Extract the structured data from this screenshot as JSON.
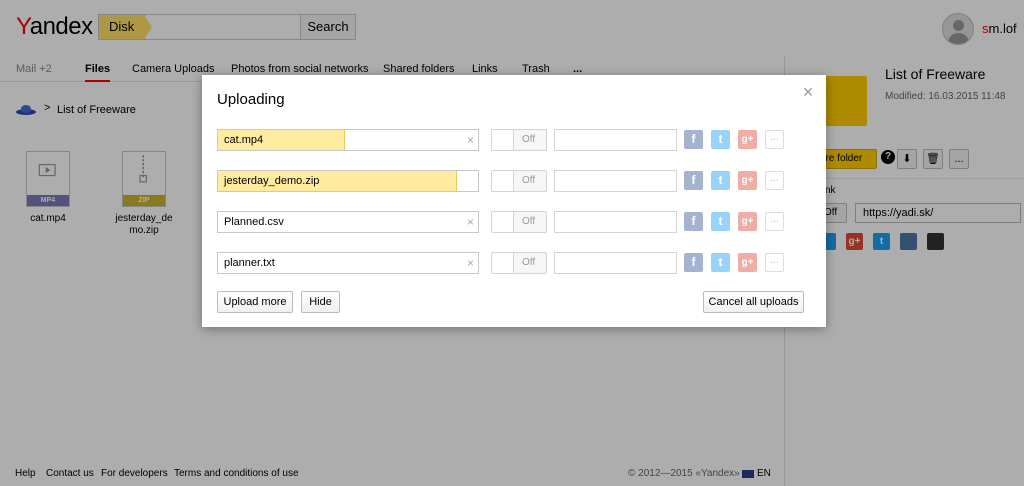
{
  "header": {
    "logo_y": "Y",
    "logo_rest": "andex",
    "search_tag": "Disk",
    "search_button": "Search",
    "user_first_letter": "s",
    "user_rest": "m.lof"
  },
  "tabs": [
    {
      "label": "Mail +2"
    },
    {
      "label": "Files"
    },
    {
      "label": "Camera Uploads"
    },
    {
      "label": "Photos from social networks"
    },
    {
      "label": "Shared folders"
    },
    {
      "label": "Links"
    },
    {
      "label": "Trash"
    },
    {
      "label": "..."
    }
  ],
  "breadcrumb": {
    "separator": ">",
    "label": "List of Freeware"
  },
  "files": [
    {
      "name": "cat.mp4",
      "badge": "MP4"
    },
    {
      "name": "jesterday_de mo.zip",
      "badge": "ZIP"
    }
  ],
  "right_panel": {
    "title": "List of Freeware",
    "modified": "Modified: 16.03.2015 11:48",
    "share_folder": "are folder",
    "help": "?",
    "download": "⬇",
    "delete": "🗑",
    "more": "...",
    "link_label": "nk",
    "toggle": "Off",
    "url": "https://yadi.sk/"
  },
  "footer": {
    "help": "Help",
    "contact": "Contact us",
    "developers": "For developers",
    "terms": "Terms and conditions of use",
    "copyright": "© 2012—2015 «Yandex»",
    "lang": "EN"
  },
  "modal": {
    "title": "Uploading",
    "close": "×",
    "rows": [
      {
        "file": "cat.mp4",
        "progress_percent": 49,
        "toggle": "Off",
        "clear": "×"
      },
      {
        "file": "jesterday_demo.zip",
        "progress_percent": 92,
        "toggle": "Off",
        "clear": ""
      },
      {
        "file": "Planned.csv",
        "progress_percent": 0,
        "toggle": "Off",
        "clear": "×"
      },
      {
        "file": "planner.txt",
        "progress_percent": 0,
        "toggle": "Off",
        "clear": "×"
      }
    ],
    "social": {
      "facebook": "f",
      "twitter": "t",
      "google_plus": "g+",
      "more": "..."
    },
    "upload_more": "Upload more",
    "hide": "Hide",
    "cancel_all": "Cancel all uploads"
  },
  "colors": {
    "facebook": "#3b5998",
    "twitter": "#1da1f2",
    "google_plus": "#dd4b39",
    "accent_yellow": "#ffcc00",
    "progress": "#ffeba0"
  }
}
